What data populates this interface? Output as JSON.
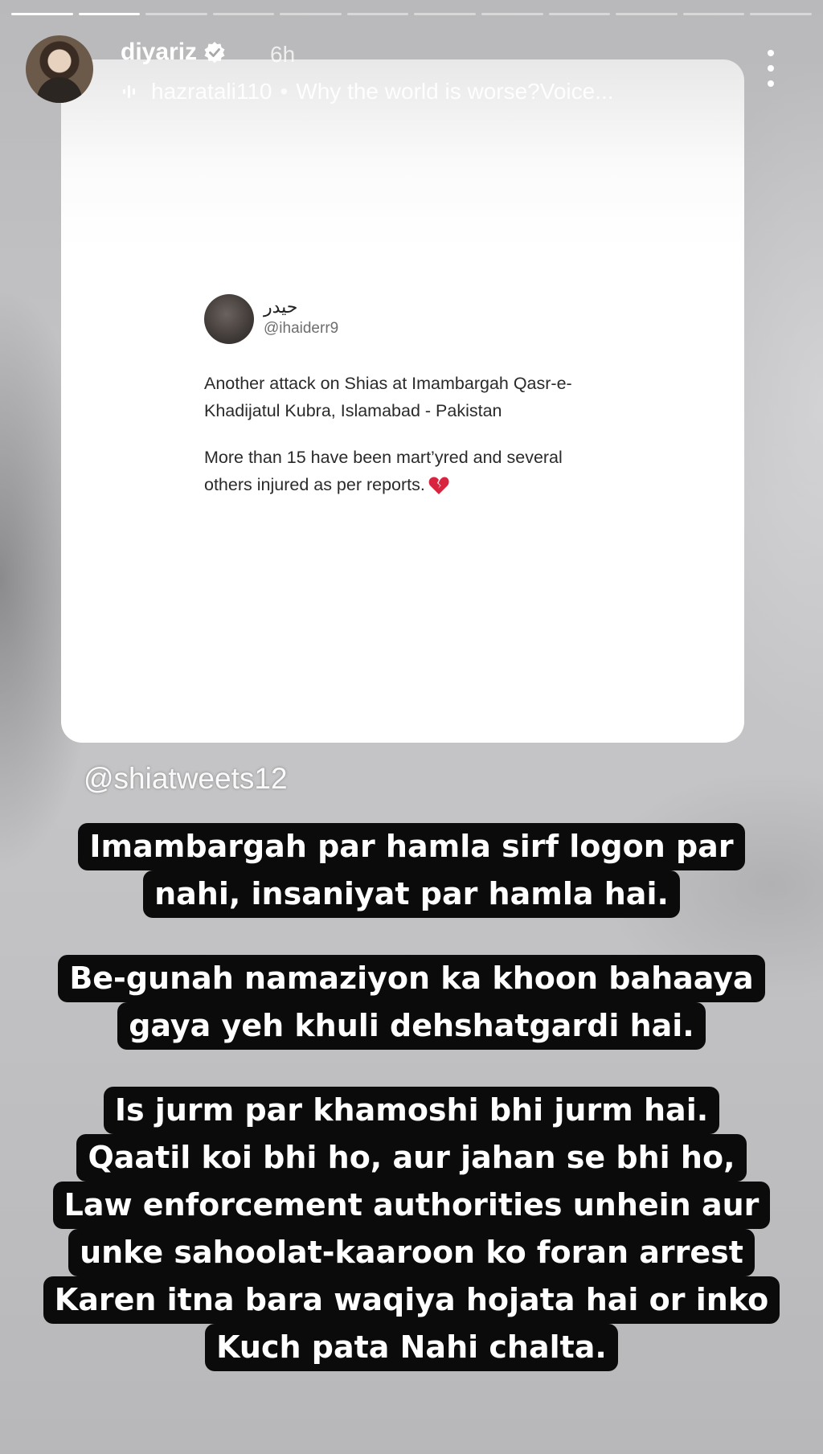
{
  "story": {
    "progress_segments": 12,
    "progress_done": 2,
    "user": {
      "name": "diyariz",
      "verified": true,
      "time_ago": "6h"
    },
    "music": {
      "artist": "hazratali110",
      "separator": "•",
      "title": "Why the world is worse?Voice..."
    },
    "menu_icon": "more-vertical-icon"
  },
  "tweet": {
    "display_name": "حیدر",
    "handle": "@ihaiderr9",
    "paragraph1_line1": "Another attack on Shias at Imambargah Qasr-e-",
    "paragraph1_line2": "Khadijatul Kubra, Islamabad - Pakistan",
    "paragraph2_line1": "More than 15 have been mart’yred and several",
    "paragraph2_line2": "others injured as per reports.",
    "emoji": "broken-heart-icon"
  },
  "mention": "@shiatweets12",
  "captions": [
    {
      "lines": [
        "Imambargah par hamla sirf logon par",
        "nahi, insaniyat par hamla hai."
      ]
    },
    {
      "lines": [
        "Be-gunah namaziyon ka khoon bahaaya",
        "gaya  yeh khuli dehshatgardi hai."
      ]
    },
    {
      "lines": [
        "Is jurm par khamoshi bhi jurm hai.",
        "Qaatil koi bhi ho, aur jahan se bhi ho,",
        "Law enforcement authorities unhein aur",
        "unke sahoolat-kaaroon ko foran arrest",
        "Karen  itna bara waqiya hojata hai or inko",
        "Kuch pata Nahi chalta."
      ]
    }
  ],
  "colors": {
    "caption_bg": "#0b0b0b",
    "caption_text": "#ffffff",
    "verified_badge": "#ffffff"
  }
}
